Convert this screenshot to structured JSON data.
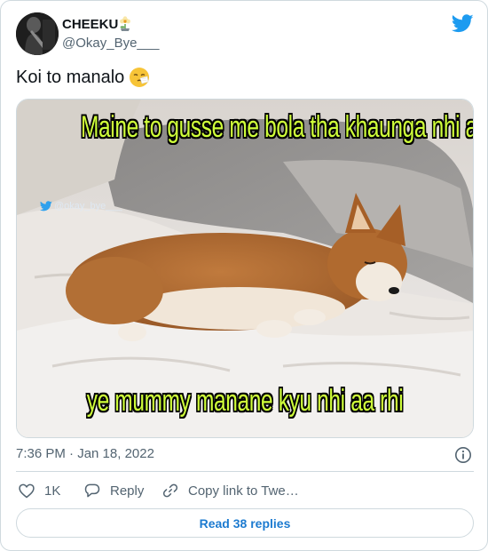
{
  "author": {
    "display_name": "CHEEKU",
    "name_emoji": "flower-emoji",
    "handle": "@Okay_Bye___",
    "avatar": "avatar-image"
  },
  "brand": {
    "logo": "twitter-bird-icon",
    "color": "#1d9bf0"
  },
  "tweet": {
    "text": "Koi to manalo",
    "emoji": "sneezing-face-emoji"
  },
  "media": {
    "top_caption": "Maine to gusse me bola tha khaunga nhi aaj",
    "bottom_caption": "ye mummy manane kyu nhi aa rhi",
    "watermark": "@okay_bye___",
    "caption_color": "#cfff3a"
  },
  "meta": {
    "timestamp": "7:36 PM · Jan 18, 2022",
    "info_icon": "info-icon"
  },
  "actions": {
    "like_count": "1K",
    "reply_label": "Reply",
    "copy_label": "Copy link to Twe…"
  },
  "read_replies_label": "Read 38 replies",
  "colors": {
    "link": "#1d7bd0",
    "muted": "#536471",
    "border": "#cfd9de"
  }
}
